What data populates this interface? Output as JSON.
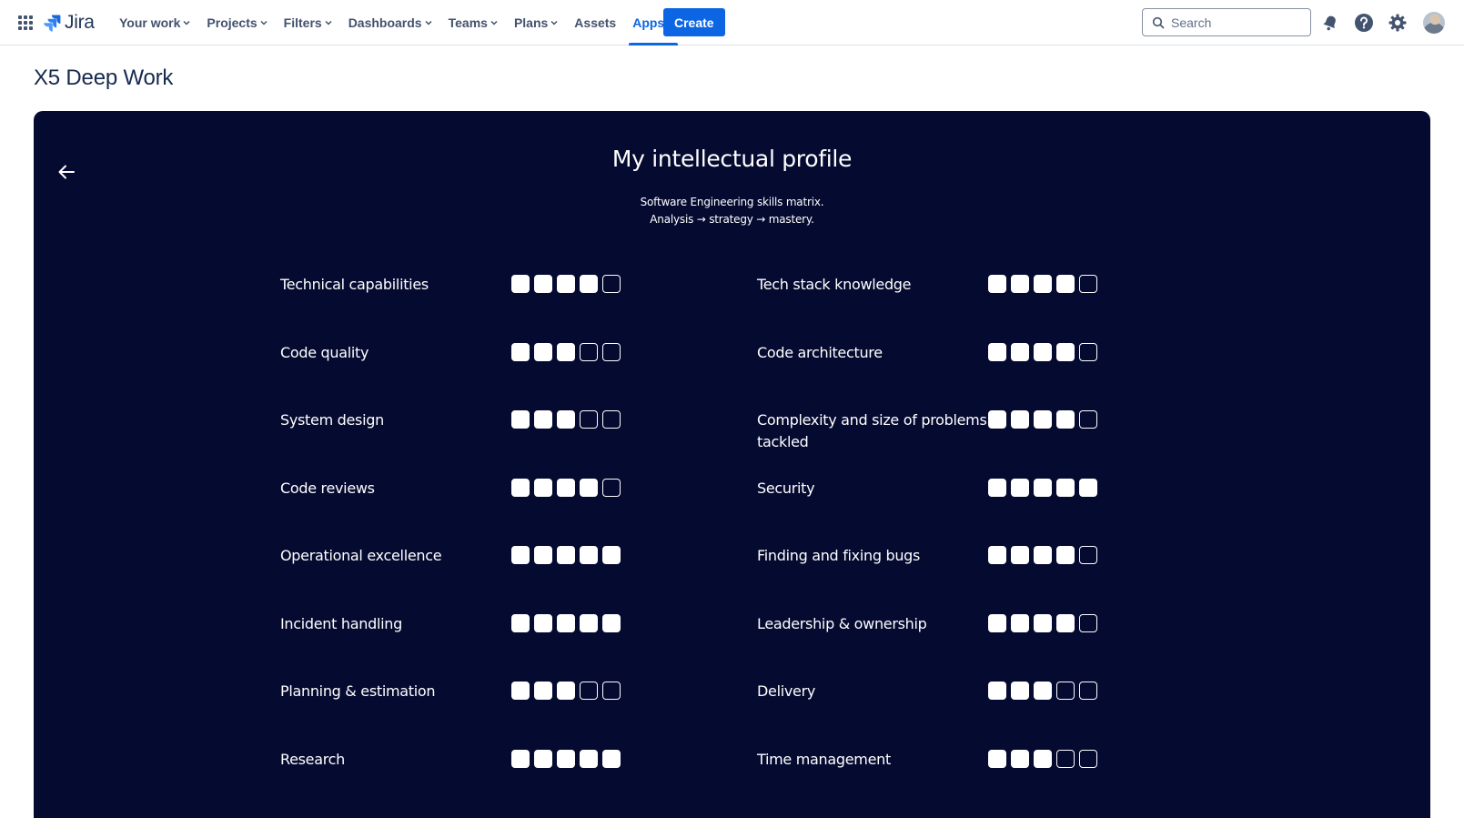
{
  "nav": {
    "product": "Jira",
    "items": [
      {
        "label": "Your work",
        "dropdown": true,
        "active": false
      },
      {
        "label": "Projects",
        "dropdown": true,
        "active": false
      },
      {
        "label": "Filters",
        "dropdown": true,
        "active": false
      },
      {
        "label": "Dashboards",
        "dropdown": true,
        "active": false
      },
      {
        "label": "Teams",
        "dropdown": true,
        "active": false
      },
      {
        "label": "Plans",
        "dropdown": true,
        "active": false
      },
      {
        "label": "Assets",
        "dropdown": false,
        "active": false
      },
      {
        "label": "Apps",
        "dropdown": true,
        "active": true
      }
    ],
    "create_label": "Create",
    "search_placeholder": "Search",
    "icons": [
      "app-switcher-icon",
      "notifications-icon",
      "help-icon",
      "settings-icon",
      "avatar"
    ]
  },
  "page": {
    "title": "X5 Deep Work"
  },
  "profile": {
    "title": "My intellectual profile",
    "subtitle_line1": "Software Engineering skills matrix.",
    "subtitle_line2": "Analysis → strategy → mastery.",
    "max_level": 5,
    "skills": [
      {
        "name": "Technical capabilities",
        "level": 4
      },
      {
        "name": "Tech stack knowledge",
        "level": 4
      },
      {
        "name": "Code quality",
        "level": 3
      },
      {
        "name": "Code architecture",
        "level": 4
      },
      {
        "name": "System design",
        "level": 3
      },
      {
        "name": "Complexity and size of problems tackled",
        "level": 4
      },
      {
        "name": "Code reviews",
        "level": 4
      },
      {
        "name": "Security",
        "level": 5
      },
      {
        "name": "Operational excellence",
        "level": 5
      },
      {
        "name": "Finding and fixing bugs",
        "level": 4
      },
      {
        "name": "Incident handling",
        "level": 5
      },
      {
        "name": "Leadership & ownership",
        "level": 4
      },
      {
        "name": "Planning & estimation",
        "level": 3
      },
      {
        "name": "Delivery",
        "level": 3
      },
      {
        "name": "Research",
        "level": 5
      },
      {
        "name": "Time management",
        "level": 3
      }
    ]
  },
  "colors": {
    "accent": "#0c66e4",
    "panel_bg": "#050a30",
    "text": "#172b4d"
  }
}
